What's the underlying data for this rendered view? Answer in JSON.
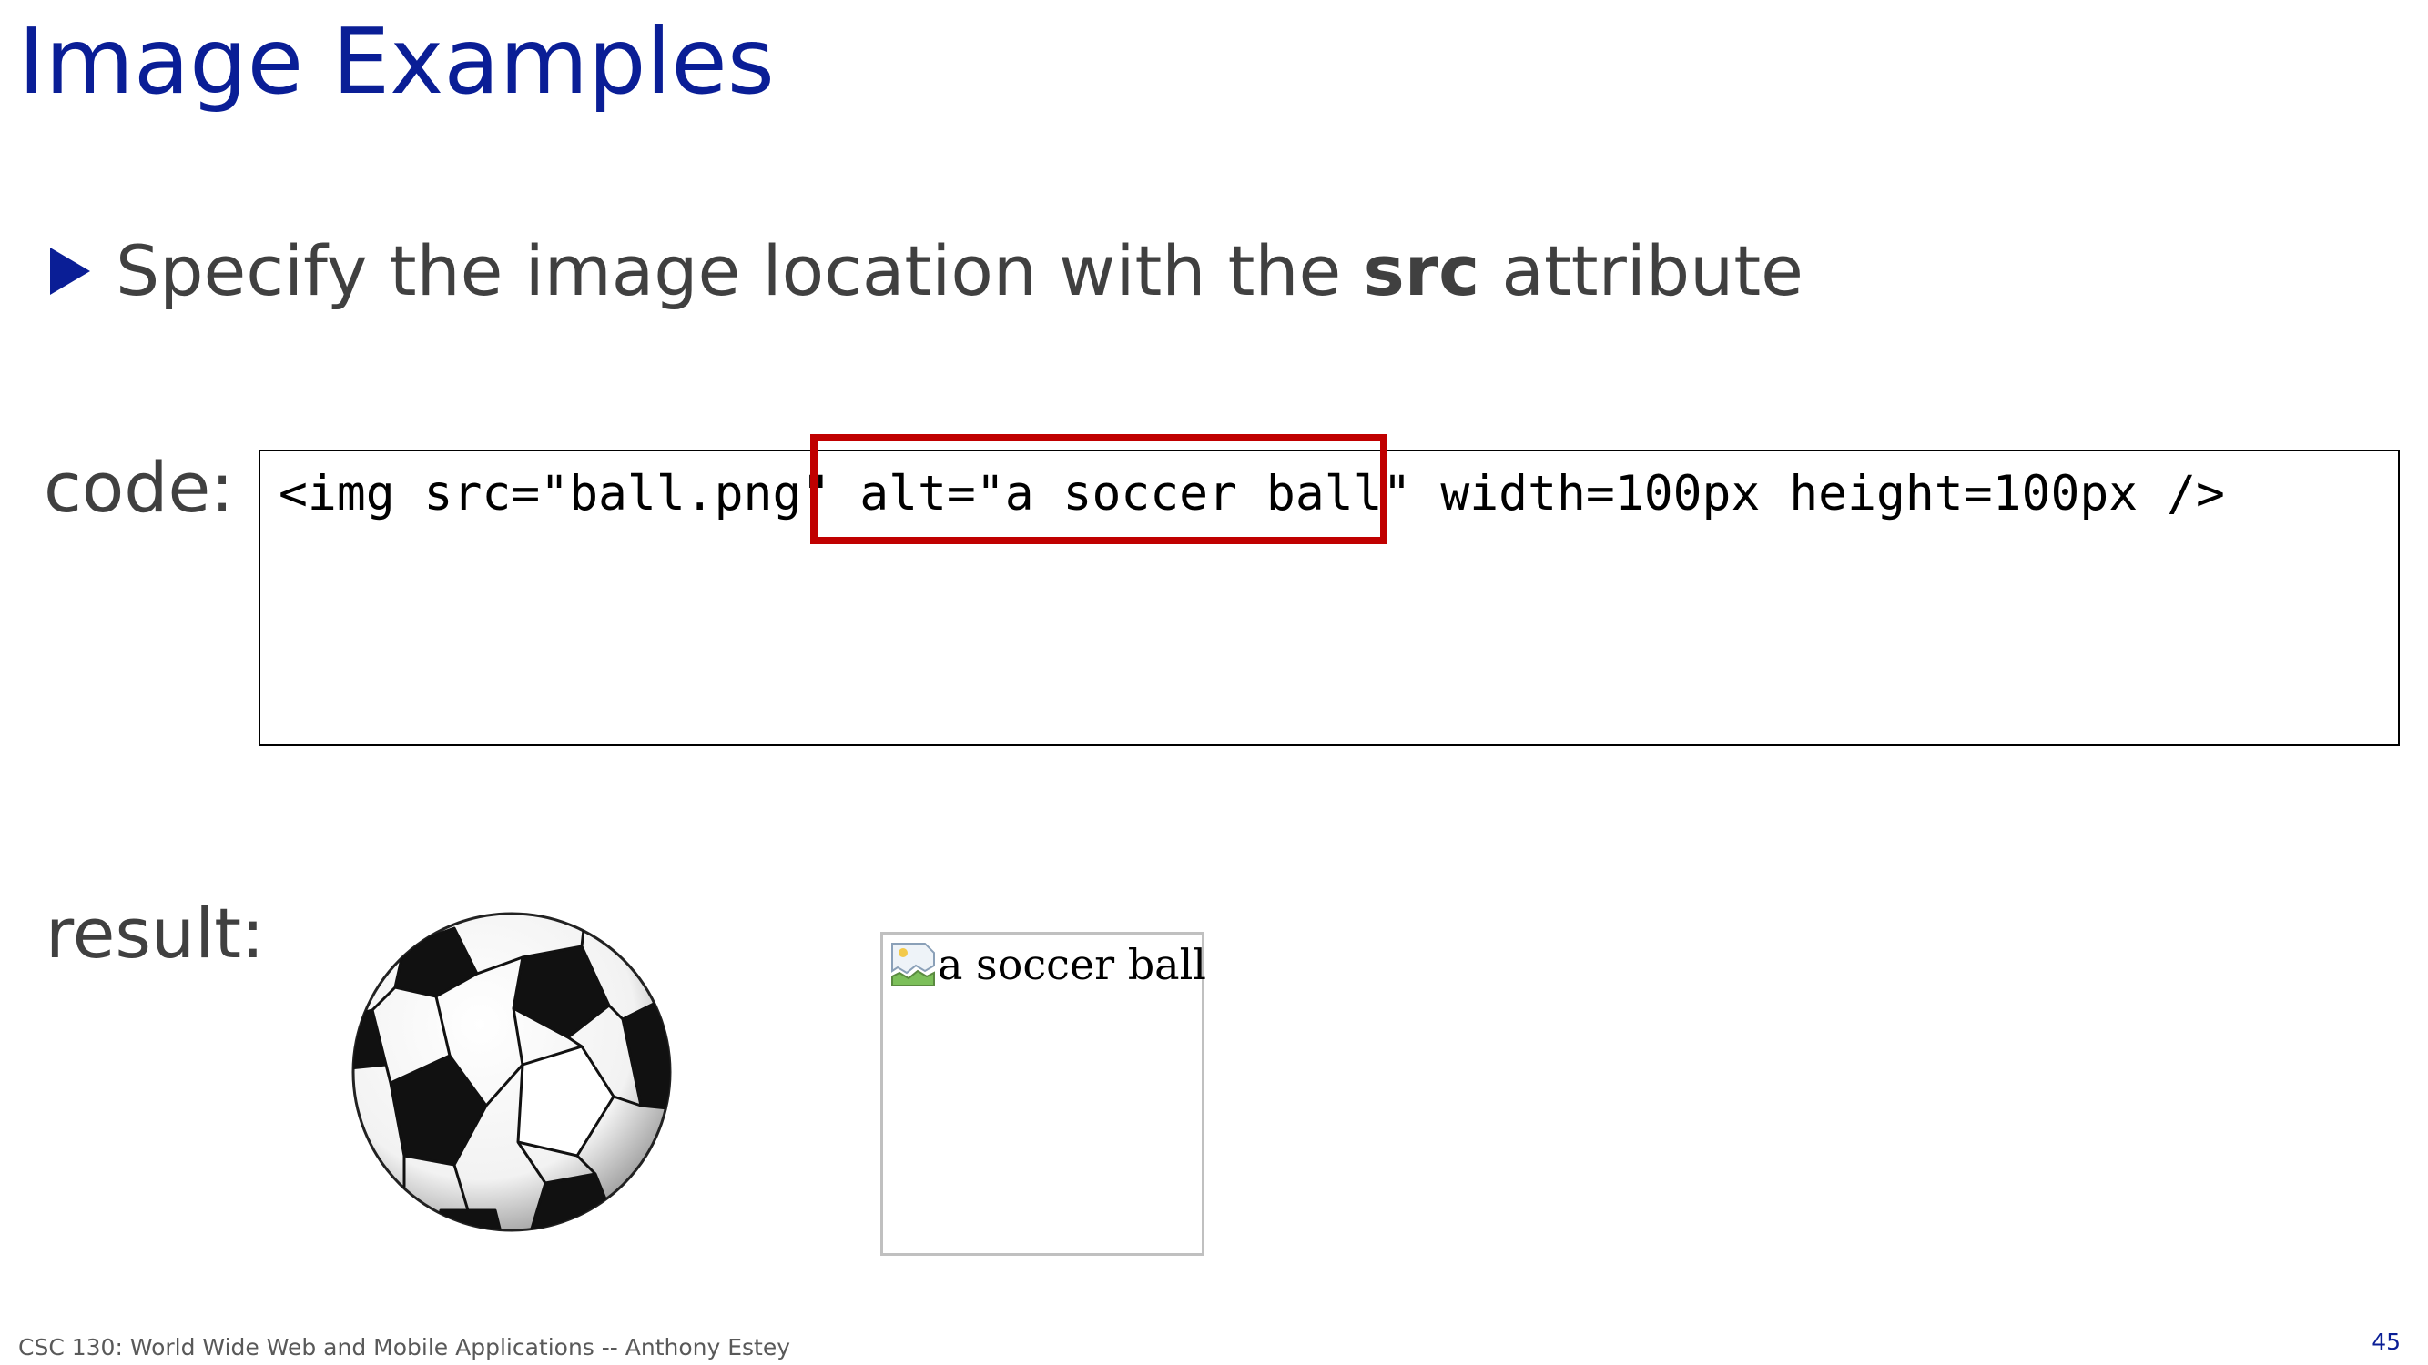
{
  "slide": {
    "title": "Image Examples",
    "bullet": {
      "text_before": "Specify the image location with the ",
      "bold_text": "src",
      "text_after": " attribute"
    },
    "code_label": "code:",
    "result_label": "result:",
    "code": {
      "part1": "<img src=\"ball.png\" ",
      "part2": "alt=\"a soccer ball\"",
      "part3": " width=100px height=100px />"
    },
    "result": {
      "rendered_image": "soccer-ball",
      "broken_image_alt_text": "a soccer ball"
    },
    "footer": "CSC 130: World Wide Web and Mobile Applications -- Anthony Estey",
    "page_number": "45"
  },
  "colors": {
    "title": "#0a1e96",
    "body_text": "#404040",
    "highlight": "#c00000"
  }
}
